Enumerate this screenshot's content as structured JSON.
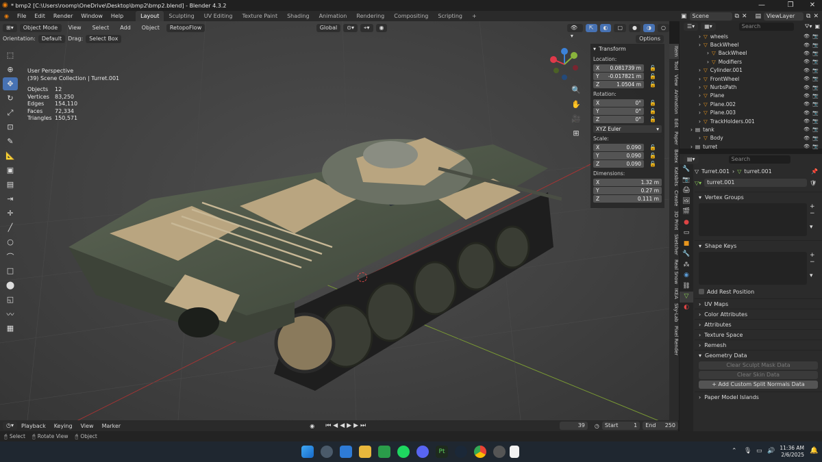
{
  "window": {
    "title": "* bmp2 [C:\\Users\\roomp\\OneDrive\\Desktop\\bmp2\\bmp2.blend] - Blender 4.3.2"
  },
  "menu": [
    "File",
    "Edit",
    "Render",
    "Window",
    "Help"
  ],
  "workspaces": [
    "Layout",
    "Sculpting",
    "UV Editing",
    "Texture Paint",
    "Shading",
    "Animation",
    "Rendering",
    "Compositing",
    "Scripting"
  ],
  "scene": {
    "name": "Scene",
    "view_layer": "ViewLayer"
  },
  "viewport_header": {
    "mode": "Object Mode",
    "menus": [
      "View",
      "Select",
      "Add",
      "Object",
      "RetopoFlow"
    ],
    "transform_orientation": "Global",
    "orientation_label": "Orientation:",
    "orientation_value": "Default",
    "drag_label": "Drag:",
    "drag_value": "Select Box",
    "options": "Options"
  },
  "overlay_text": {
    "view": "User Perspective",
    "collection": "(39) Scene Collection | Turret.001"
  },
  "stats": [
    {
      "k": "Objects",
      "v": "12"
    },
    {
      "k": "Vertices",
      "v": "83,250"
    },
    {
      "k": "Edges",
      "v": "154,110"
    },
    {
      "k": "Faces",
      "v": "72,334"
    },
    {
      "k": "Triangles",
      "v": "150,571"
    }
  ],
  "transform": {
    "title": "Transform",
    "location_label": "Location:",
    "location": [
      {
        "a": "X",
        "v": "0.081739 m"
      },
      {
        "a": "Y",
        "v": "-0.017821 m"
      },
      {
        "a": "Z",
        "v": "1.0504 m"
      }
    ],
    "rotation_label": "Rotation:",
    "rotation": [
      {
        "a": "X",
        "v": "0°"
      },
      {
        "a": "Y",
        "v": "0°"
      },
      {
        "a": "Z",
        "v": "0°"
      }
    ],
    "rotation_mode": "XYZ Euler",
    "scale_label": "Scale:",
    "scale": [
      {
        "a": "X",
        "v": "0.090"
      },
      {
        "a": "Y",
        "v": "0.090"
      },
      {
        "a": "Z",
        "v": "0.090"
      }
    ],
    "dimensions_label": "Dimensions:",
    "dimensions": [
      {
        "a": "X",
        "v": "1.32 m"
      },
      {
        "a": "Y",
        "v": "0.27 m"
      },
      {
        "a": "Z",
        "v": "0.111 m"
      }
    ]
  },
  "side_tabs": [
    "Item",
    "Tool",
    "View",
    "Animation",
    "Edit",
    "Paper",
    "Batex",
    "Katsbits",
    "Create",
    "3D Print",
    "Sketcher",
    "Real Snow",
    "IKEA",
    "Sky-Lab",
    "Pixel Render"
  ],
  "outliner": {
    "search_placeholder": "Search",
    "rows": [
      {
        "name": "wheels",
        "indent": 2
      },
      {
        "name": "BackWheel",
        "indent": 2
      },
      {
        "name": "BackWheel",
        "indent": 3
      },
      {
        "name": "Modifiers",
        "indent": 3
      },
      {
        "name": "Cylinder.001",
        "indent": 2
      },
      {
        "name": "FrontWheel",
        "indent": 2
      },
      {
        "name": "NurbsPath",
        "indent": 2
      },
      {
        "name": "Plane",
        "indent": 2
      },
      {
        "name": "Plane.002",
        "indent": 2
      },
      {
        "name": "Plane.003",
        "indent": 2
      },
      {
        "name": "TrackHolders.001",
        "indent": 2
      },
      {
        "name": "tank",
        "indent": 1
      },
      {
        "name": "Body",
        "indent": 2
      },
      {
        "name": "turret",
        "indent": 1
      }
    ]
  },
  "properties": {
    "search_placeholder": "Search",
    "breadcrumb_object": "Turret.001",
    "breadcrumb_data": "turret.001",
    "mesh_name": "turret.001",
    "sections": [
      "Vertex Groups",
      "Shape Keys",
      "UV Maps",
      "Color Attributes",
      "Attributes",
      "Texture Space",
      "Remesh",
      "Geometry Data",
      "Paper Model Islands"
    ],
    "add_rest_position": "Add Rest Position",
    "clear_sculpt": "Clear Sculpt Mask Data",
    "clear_skin": "Clear Skin Data",
    "add_normals": "Add Custom Split Normals Data"
  },
  "timeline": {
    "menus": [
      "Playback",
      "Keying",
      "View",
      "Marker"
    ],
    "current_frame": "39",
    "start_label": "Start",
    "start": "1",
    "end_label": "End",
    "end": "250"
  },
  "statusbar": {
    "select": "Select",
    "rotate": "Rotate View",
    "object": "Object"
  },
  "taskbar": {
    "time": "11:36 AM",
    "date": "2/6/2025"
  },
  "colors": {
    "accent": "#4772b3",
    "x_axis": "#e0394a",
    "y_axis": "#89b43c",
    "z_axis": "#3c82d8"
  }
}
